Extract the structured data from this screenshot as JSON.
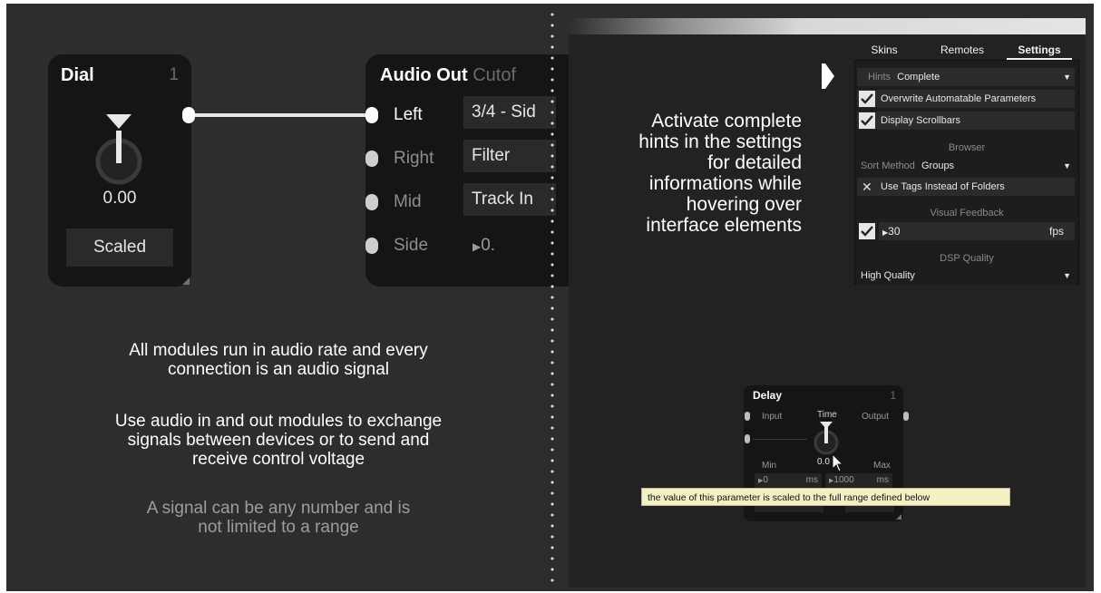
{
  "dial_module": {
    "title": "Dial",
    "number": "1",
    "value": "0.00",
    "mode_button": "Scaled"
  },
  "audio_out_module": {
    "title": "Audio Out",
    "title_suffix": "Cutof",
    "ports": [
      {
        "label": "Left",
        "value": "3/4 - Sid"
      },
      {
        "label": "Right",
        "value": "Filter"
      },
      {
        "label": "Mid",
        "value": "Track In"
      },
      {
        "label": "Side",
        "value": "0."
      }
    ]
  },
  "left_text": {
    "para1": [
      "All modules run in audio rate and every",
      "connection is an audio signal"
    ],
    "para2": [
      "Use audio in and out modules to exchange",
      "signals between devices or to send and",
      "receive control voltage"
    ],
    "para3": [
      "A signal can be any number and is",
      "not limited to a range"
    ]
  },
  "hint_text": [
    "Activate complete",
    "hints in the settings",
    "for detailed",
    "informations while",
    "hovering over",
    "interface elements"
  ],
  "tabs": [
    {
      "label": "Skins",
      "active": false
    },
    {
      "label": "Remotes",
      "active": false
    },
    {
      "label": "Settings",
      "active": true
    }
  ],
  "settings": {
    "hints_label": "Hints",
    "hints_value": "Complete",
    "overwrite_label": "Overwrite Automatable Parameters",
    "overwrite_checked": true,
    "scrollbars_label": "Display Scrollbars",
    "scrollbars_checked": true,
    "browser_section": "Browser",
    "sort_label": "Sort Method",
    "sort_value": "Groups",
    "tags_label": "Use Tags Instead of Folders",
    "tags_checked": false,
    "visual_section": "Visual Feedback",
    "visual_checked": true,
    "fps_value": "30",
    "fps_unit": "fps",
    "dsp_section": "DSP Quality",
    "dsp_value": "High Quality"
  },
  "delay_module": {
    "title": "Delay",
    "number": "1",
    "input_label": "Input",
    "time_label": "Time",
    "output_label": "Output",
    "value": "0.0",
    "min_label": "Min",
    "max_label": "Max",
    "min_value": "0",
    "min_unit": "ms",
    "max_value": "1000",
    "max_unit": "ms"
  },
  "tooltip": "the value of this parameter is scaled to the full range defined below",
  "colors": {
    "background": "#2d2d2d",
    "module_bg": "#151515",
    "tooltip_bg": "#f3f1c4"
  }
}
